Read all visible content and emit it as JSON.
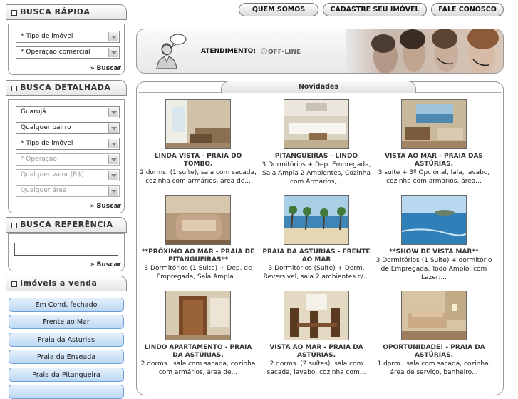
{
  "nav": {
    "quem_somos": "QUEM SOMOS",
    "cadastre": "CADASTRE SEU IMÓVEL",
    "fale_conosco": "FALE CONOSCO"
  },
  "busca_rapida": {
    "title": "BUSCA RÁPIDA",
    "tipo": "* Tipo de imóvel",
    "operacao": "* Operação comercial",
    "buscar": "Buscar"
  },
  "busca_detalhada": {
    "title": "BUSCA DETALHADA",
    "cidade": "Guarujá",
    "bairro": "Qualquer bairro",
    "tipo": "* Tipo de imóvel",
    "operacao": "* Operação",
    "valor": "Qualquer valor (R$)",
    "area": "Qualquer área",
    "buscar": "Buscar"
  },
  "busca_referencia": {
    "title": "BUSCA REFERÊNCIA",
    "input_value": "",
    "buscar": "Buscar"
  },
  "imoveis_venda": {
    "title": "Imóveis a venda",
    "items": [
      {
        "label": "Em Cond. fechado"
      },
      {
        "label": "Frente ao Mar"
      },
      {
        "label": "Praia da Asturias"
      },
      {
        "label": "Praia da Enseada"
      },
      {
        "label": "Praia da Pitangueira"
      }
    ]
  },
  "atendimento": {
    "label": "ATENDIMENTO:",
    "status": "OFF-LINE"
  },
  "novidades": {
    "title": "Novidades",
    "cards": [
      {
        "title": "LINDA VISTA - PRAIA DO TOMBO.",
        "desc": "2 dorms. (1 suíte), sala com sacada, cozinha com armários, área de...",
        "photo": "living-room"
      },
      {
        "title": "PITANGUEIRAS - LINDO",
        "desc": "3 Dormitórios + Dep. Empregada, Sala Ampla 2 Ambientes, Cozinha com Armários,...",
        "photo": "white-sofa-room"
      },
      {
        "title": "VISTA AO MAR - PRAIA DAS ASTÚRIAS.",
        "desc": "3 suíte + 3º Opcional, lala, lavabo, cozinha com armários, área...",
        "photo": "sea-view-room"
      },
      {
        "title": "**PRÓXIMO AO MAR - PRAIA DE PITANGUEIRAS**",
        "desc": "3 Dormitórios (1 Suite) + Dep. de Empregada, Sala Ampla...",
        "photo": "armchair"
      },
      {
        "title": "PRAIA DA ASTURIAS - FRENTE AO MAR",
        "desc": "3 Dormitórios (Suite) + Dorm. Reversível, sala 2 ambientes c/...",
        "photo": "beach-palms"
      },
      {
        "title": "**SHOW DE VISTA MAR**",
        "desc": "3 Dormitórios (1 Suite) + dormitório de Empregada, Todo Amplo, com Lazer:...",
        "photo": "ocean-view"
      },
      {
        "title": "LINDO APARTAMENTO - PRAIA DA ASTÚRIAS.",
        "desc": "2 dorms., sala com sacada, cozinha com armários, área de...",
        "photo": "wood-door"
      },
      {
        "title": "VISTA AO MAR - PRAIA DA ASTÚRIAS.",
        "desc": "2 dorms. (2 suítes), sala com sacada, lavabo, cozinha com...",
        "photo": "dining-chairs"
      },
      {
        "title": "OPORTUNIDADE! - PRAIA DA ASTÚRIAS.",
        "desc": "1 dorm., sala com sacada, cozinha, área de serviço, banheiro...",
        "photo": "sofa-lamp"
      }
    ]
  }
}
